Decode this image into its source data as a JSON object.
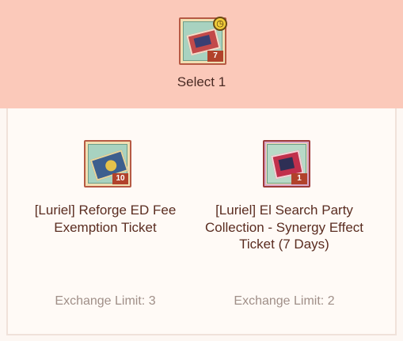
{
  "header": {
    "selected_item": {
      "icon": "red-ticket-icon",
      "badge": "clock-icon",
      "quantity": "7"
    },
    "select_label": "Select 1"
  },
  "items": [
    {
      "icon": "blue-ticket-icon",
      "quantity": "10",
      "name": "[Luriel] Reforge ED Fee Exemption Ticket",
      "limit": "Exchange Limit: 3"
    },
    {
      "icon": "pink-ticket-icon",
      "quantity": "1",
      "name": "[Luriel] El Search Party Collection - Synergy Effect Ticket (7 Days)",
      "limit": "Exchange Limit: 2"
    }
  ],
  "colors": {
    "header_bg": "#fbc9ba",
    "panel_bg": "#fffaf6",
    "text_dark": "#5a2c20",
    "text_muted": "#a08f88",
    "quantity_badge": "#b1422b"
  }
}
